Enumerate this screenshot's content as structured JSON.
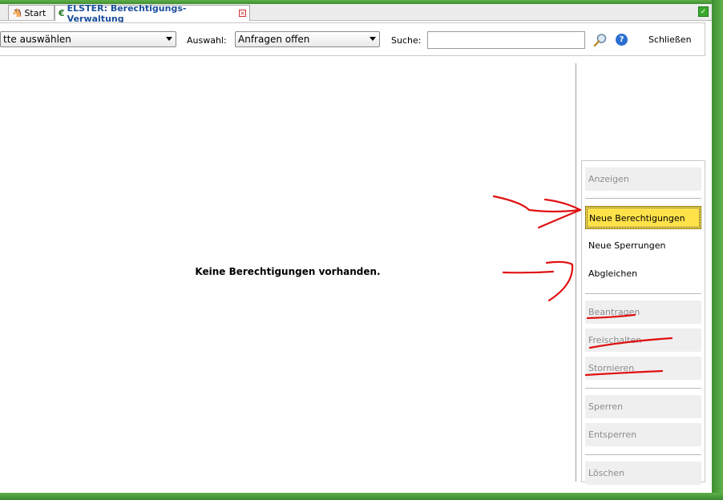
{
  "tabs": [
    {
      "label": "Start"
    },
    {
      "label": "ELSTER: Berechtigungs-Verwaltung"
    }
  ],
  "toolbar": {
    "first_combo_value": "tte auswählen",
    "auswahl_label": "Auswahl:",
    "auswahl_value": "Anfragen offen",
    "suche_label": "Suche:",
    "search_value": "",
    "close_label": "Schließen"
  },
  "content": {
    "empty_message": "Keine Berechtigungen vorhanden."
  },
  "actions": {
    "anzeigen": "Anzeigen",
    "neue_berechtigungen": "Neue Berechtigungen",
    "neue_sperrungen": "Neue Sperrungen",
    "abgleichen": "Abgleichen",
    "beantragen": "Beantragen",
    "freischalten": "Freischalten",
    "stornieren": "Stornieren",
    "sperren": "Sperren",
    "entsperren": "Entsperren",
    "loeschen": "Löschen"
  },
  "colors": {
    "frame": "#4a9d3a",
    "highlight": "#ffe24a",
    "annotation": "#e01010",
    "tab_title": "#1a4f9c"
  }
}
